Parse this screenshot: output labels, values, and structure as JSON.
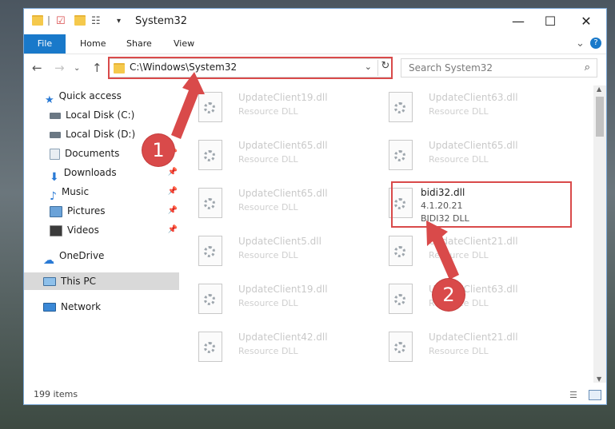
{
  "window": {
    "title": "System32",
    "controls": {
      "minimize": "—",
      "maximize": "☐",
      "close": "✕"
    }
  },
  "ribbon": {
    "tabs": [
      "File",
      "Home",
      "Share",
      "View"
    ],
    "expand_icon": "⌄",
    "help_icon": "?"
  },
  "nav": {
    "back": "←",
    "forward": "→",
    "recent": "⌄",
    "up": "↑",
    "address": "C:\\Windows\\System32",
    "search_placeholder": "Search System32"
  },
  "sidebar": {
    "items": [
      {
        "label": "Quick access",
        "icon": "star-icon"
      },
      {
        "label": "Local Disk (C:)",
        "icon": "drive-icon"
      },
      {
        "label": "Local Disk (D:)",
        "icon": "drive-icon"
      },
      {
        "label": "Documents",
        "icon": "documents-icon",
        "pinned": true
      },
      {
        "label": "Downloads",
        "icon": "download-icon",
        "pinned": true
      },
      {
        "label": "Music",
        "icon": "music-icon",
        "pinned": true
      },
      {
        "label": "Pictures",
        "icon": "pictures-icon",
        "pinned": true
      },
      {
        "label": "Videos",
        "icon": "videos-icon",
        "pinned": true
      },
      {
        "label": "OneDrive",
        "icon": "cloud-icon"
      },
      {
        "label": "This PC",
        "icon": "computer-icon",
        "selected": true
      },
      {
        "label": "Network",
        "icon": "network-icon"
      }
    ]
  },
  "files": [
    {
      "name": "UpdateClient19.dll",
      "desc": "Resource DLL"
    },
    {
      "name": "UpdateClient63.dll",
      "desc": "Resource DLL"
    },
    {
      "name": "UpdateClient65.dll",
      "desc": "Resource DLL"
    },
    {
      "name": "UpdateClient65.dll",
      "desc": "Resource DLL"
    },
    {
      "name": "UpdateClient65.dll",
      "desc": "Resource DLL"
    },
    {
      "name": "bidi32.dll",
      "desc": "4.1.20.21",
      "desc2": "BIDI32 DLL",
      "selected": true
    },
    {
      "name": "UpdateClient5.dll",
      "desc": "Resource DLL"
    },
    {
      "name": "UpdateClient21.dll",
      "desc": "Resource DLL"
    },
    {
      "name": "UpdateClient19.dll",
      "desc": "Resource DLL"
    },
    {
      "name": "UpdateClient63.dll",
      "desc": "Resource DLL"
    },
    {
      "name": "UpdateClient42.dll",
      "desc": "Resource DLL"
    },
    {
      "name": "UpdateClient21.dll",
      "desc": "Resource DLL"
    }
  ],
  "status": {
    "item_count": "199 items"
  },
  "annotations": {
    "step1": "1",
    "step2": "2"
  },
  "colors": {
    "accent": "#1979ca",
    "annotation": "#d94a4a"
  }
}
